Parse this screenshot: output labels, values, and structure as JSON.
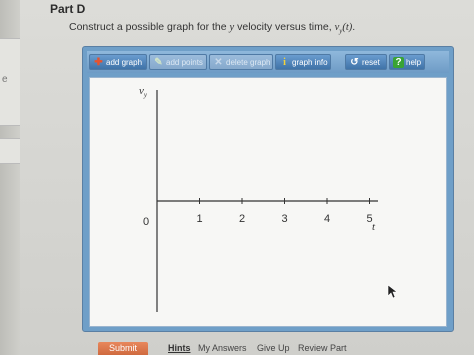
{
  "part": {
    "title": "Part D"
  },
  "question": {
    "prefix": "Construct a possible graph for the ",
    "var_y": "y",
    "middle": " velocity versus time, ",
    "formula": "v",
    "formula_sub": "y",
    "formula_tail": "(t)",
    "suffix": "."
  },
  "left_strip": {
    "tab_letter": "e"
  },
  "toolbar": {
    "add_graph": "add graph",
    "add_points": "add points",
    "delete_graph": "delete graph",
    "graph_info": "graph info",
    "reset": "reset",
    "help": "help"
  },
  "graph": {
    "y_axis_label": "v",
    "y_axis_sub": "y",
    "x_axis_label": "t",
    "x_ticks": [
      "0",
      "1",
      "2",
      "3",
      "4",
      "5"
    ],
    "colors": {
      "axis": "#333333",
      "background": "#f7f7f5"
    }
  },
  "actions": {
    "submit": "Submit",
    "hints": "Hints",
    "my_answers": "My Answers",
    "give_up": "Give Up",
    "review_part": "Review Part"
  },
  "icons": {
    "add_graph": "plus-icon",
    "add_points": "pencil-icon",
    "delete_graph": "x-icon",
    "graph_info": "info-icon",
    "reset": "reset-icon",
    "help": "help-icon",
    "cursor": "cursor-icon"
  }
}
